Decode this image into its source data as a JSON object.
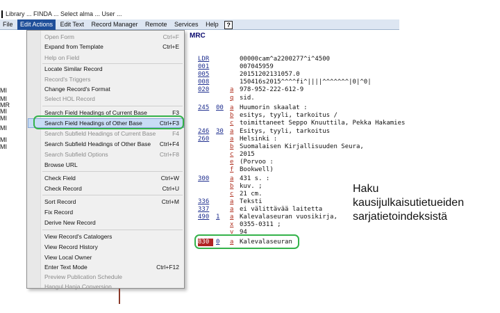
{
  "titlebar": {
    "text": "Library ... FINDA ... Select alma ... User ..."
  },
  "menubar": {
    "items": [
      {
        "label": "File"
      },
      {
        "label": "Edit Actions",
        "active": true
      },
      {
        "label": "Edit Text"
      },
      {
        "label": "Record Manager"
      },
      {
        "label": "Remote"
      },
      {
        "label": "Services"
      },
      {
        "label": "Help"
      }
    ],
    "help_label": "?"
  },
  "leftstrip": {
    "labels": [
      "MI",
      "MI",
      "MR",
      "MI",
      "MI",
      "MI",
      "MI",
      "MI"
    ]
  },
  "dropdown": {
    "items": [
      {
        "label": "Open Form",
        "shortcut": "Ctrl+F",
        "disabled": true
      },
      {
        "label": "Expand from Template",
        "shortcut": "Ctrl+E",
        "disabled": false
      },
      {
        "label": "Help on Field",
        "shortcut": "",
        "disabled": true
      },
      {
        "label": "Locate Similar Record",
        "shortcut": "",
        "disabled": false
      },
      {
        "label": "Record's Triggers",
        "shortcut": "",
        "disabled": true
      },
      {
        "label": "Change Record's Format",
        "shortcut": "",
        "disabled": false
      },
      {
        "label": "Select HOL Record",
        "shortcut": "",
        "disabled": true
      },
      {
        "label": "Search Field Headings of Current Base",
        "shortcut": "F3",
        "disabled": false
      },
      {
        "label": "Search Field Headings of Other Base",
        "shortcut": "Ctrl+F3",
        "disabled": false
      },
      {
        "label": "Search Subfield Headings of Current Base",
        "shortcut": "F4",
        "disabled": true
      },
      {
        "label": "Search Subfield Headings of Other Base",
        "shortcut": "Ctrl+F4",
        "disabled": false
      },
      {
        "label": "Search Subfield Options",
        "shortcut": "Ctrl+F8",
        "disabled": true
      },
      {
        "label": "Browse URL",
        "shortcut": "",
        "disabled": false
      },
      {
        "label": "Check Field",
        "shortcut": "Ctrl+W",
        "disabled": false
      },
      {
        "label": "Check Record",
        "shortcut": "Ctrl+U",
        "disabled": false
      },
      {
        "label": "Sort Record",
        "shortcut": "Ctrl+M",
        "disabled": false
      },
      {
        "label": "Fix Record",
        "shortcut": "",
        "disabled": false
      },
      {
        "label": "Derive New Record",
        "shortcut": "",
        "disabled": false
      },
      {
        "label": "View Record's Catalogers",
        "shortcut": "",
        "disabled": false
      },
      {
        "label": "View Record History",
        "shortcut": "",
        "disabled": false
      },
      {
        "label": "View Local Owner",
        "shortcut": "",
        "disabled": false
      },
      {
        "label": "Enter Text Mode",
        "shortcut": "Ctrl+F12",
        "disabled": false
      },
      {
        "label": "Preview Publication Schedule",
        "shortcut": "",
        "disabled": true
      },
      {
        "label": "Hangul Hanja Conversion",
        "shortcut": "",
        "disabled": true
      }
    ]
  },
  "record": {
    "header": "MRC",
    "rows": [
      {
        "tag": "LDR",
        "ind": "",
        "sf": "",
        "value": "00000cam^a2200277^i^4500"
      },
      {
        "tag": "001",
        "ind": "",
        "sf": "",
        "value": "007045959"
      },
      {
        "tag": "005",
        "ind": "",
        "sf": "",
        "value": "20151202131057.0"
      },
      {
        "tag": "008",
        "ind": "",
        "sf": "",
        "value": "150416s2015^^^^fi^||||^^^^^^^|0|^0|"
      },
      {
        "tag": "020",
        "ind": "",
        "sf": "a",
        "value": "978-952-222-612-9"
      },
      {
        "tag": "",
        "ind": "",
        "sf": "q",
        "value": "sid."
      },
      {
        "tag": "245",
        "ind": "00",
        "sf": "a",
        "value": "Huumorin skaalat :"
      },
      {
        "tag": "",
        "ind": "",
        "sf": "b",
        "value": "esitys, tyyli, tarkoitus /"
      },
      {
        "tag": "",
        "ind": "",
        "sf": "c",
        "value": "toimittaneet Seppo Knuuttila, Pekka Hakamies"
      },
      {
        "tag": "246",
        "ind": "30",
        "sf": "a",
        "value": "Esitys, tyyli, tarkoitus"
      },
      {
        "tag": "260",
        "ind": "",
        "sf": "a",
        "value": "Helsinki :"
      },
      {
        "tag": "",
        "ind": "",
        "sf": "b",
        "value": "Suomalaisen Kirjallisuuden Seura,"
      },
      {
        "tag": "",
        "ind": "",
        "sf": "c",
        "value": "2015"
      },
      {
        "tag": "",
        "ind": "",
        "sf": "e",
        "value": "(Porvoo :"
      },
      {
        "tag": "",
        "ind": "",
        "sf": "f",
        "value": "Bookwell)"
      },
      {
        "tag": "300",
        "ind": "",
        "sf": "a",
        "value": "431 s. :"
      },
      {
        "tag": "",
        "ind": "",
        "sf": "b",
        "value": "kuv. ;"
      },
      {
        "tag": "",
        "ind": "",
        "sf": "c",
        "value": "21 cm."
      },
      {
        "tag": "336",
        "ind": "",
        "sf": "a",
        "value": "Teksti"
      },
      {
        "tag": "337",
        "ind": "",
        "sf": "a",
        "value": "ei välittävää laitetta"
      },
      {
        "tag": "490",
        "ind": "1",
        "sf": "a",
        "value": "Kalevalaseuran vuosikirja,"
      },
      {
        "tag": "",
        "ind": "",
        "sf": "x",
        "value": "0355-0311 ;"
      },
      {
        "tag": "",
        "ind": "",
        "sf": "v",
        "value": "94"
      },
      {
        "tag": "830",
        "ind": "0",
        "sf": "a",
        "value": "Kalevalaseuran"
      }
    ]
  },
  "annotation": {
    "line1": "Haku",
    "line2": "kausijulkaisutietueiden",
    "line3": "sarjatietoindeksistä"
  },
  "colors": {
    "menu_active": "#1f4f9a",
    "highlight_outline": "#34b24a",
    "tag_color": "#1f2f8f",
    "subfield_color": "#b03020",
    "selected_tag_bg": "#b02525"
  }
}
